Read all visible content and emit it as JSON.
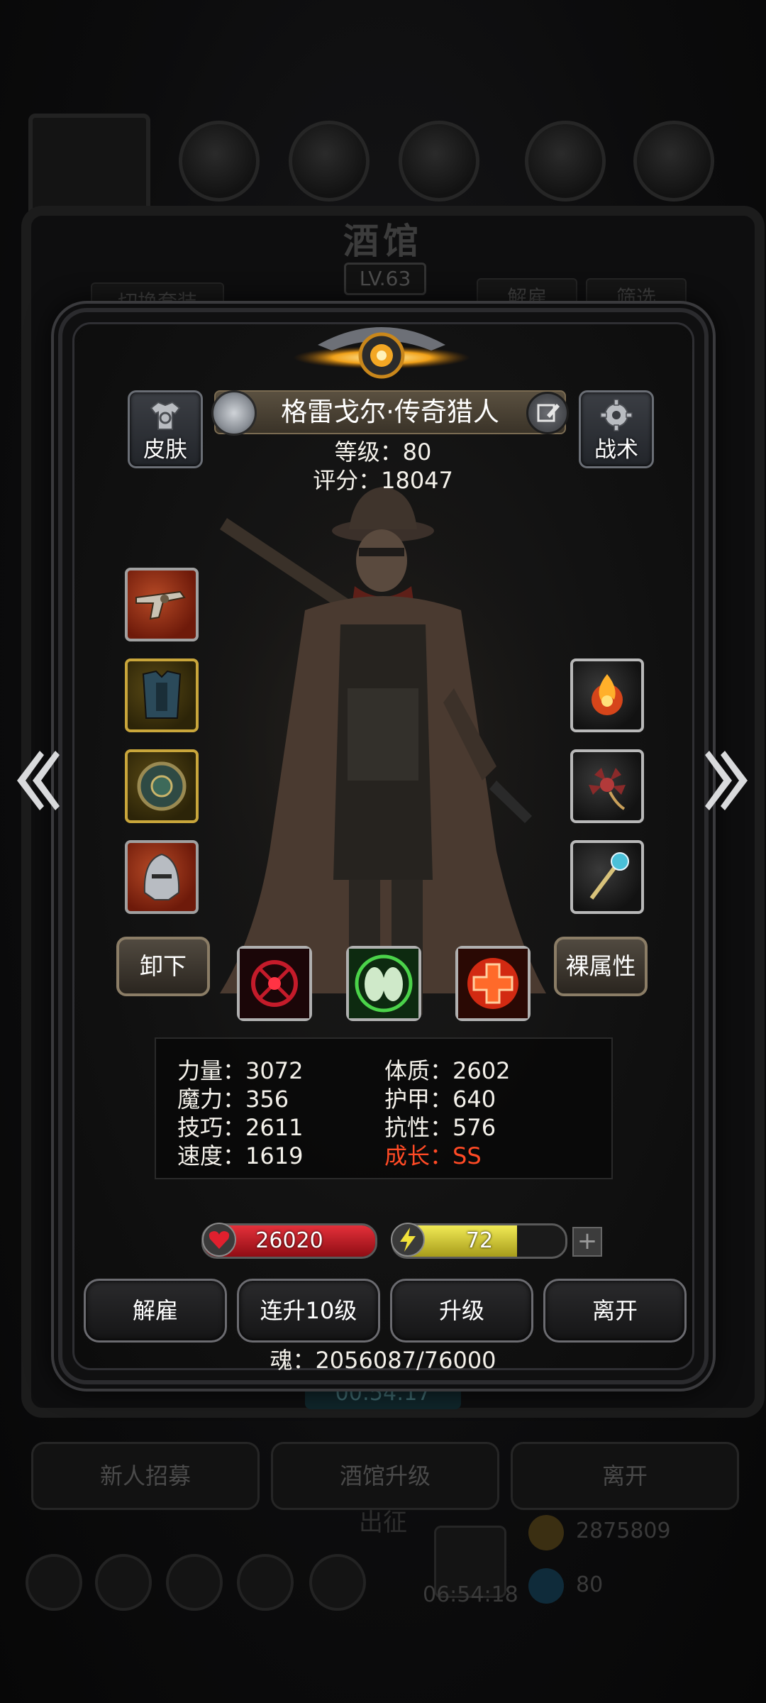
{
  "background": {
    "title": "酒馆",
    "level": "LV.63",
    "switch_outfit": "切换套装",
    "dismiss": "解雇",
    "filter": "筛选",
    "timer": "00:54:17",
    "bottom_buttons": [
      "新人招募",
      "酒馆升级",
      "离开"
    ],
    "sortie": "出征",
    "gold": "2875809",
    "dock_timer": "06:54:18",
    "gems": "80"
  },
  "hero": {
    "name": "格雷戈尔·传奇猎人",
    "level_text": "等级：80",
    "score_text": "评分：18047",
    "skin_label": "皮肤",
    "tactics_label": "战术",
    "unequip_label": "卸下",
    "base_attr_label": "裸属性"
  },
  "equipment_left": [
    "revolver-icon",
    "armor-icon",
    "shield-icon",
    "helmet-icon"
  ],
  "equipment_right": [
    "fire-orb-icon",
    "spiked-flail-icon",
    "scepter-icon"
  ],
  "skills": [
    "target-skill-icon",
    "green-skill-icon",
    "heal-skill-icon"
  ],
  "attributes": {
    "strength": "力量：3072",
    "constitution": "体质：2602",
    "magic": "魔力：356",
    "armor": "护甲：640",
    "skill": "技巧：2611",
    "resistance": "抗性：576",
    "speed": "速度：1619",
    "growth": "成长：SS"
  },
  "hp": {
    "value": "26020",
    "fill": 1.0
  },
  "energy": {
    "value": "72",
    "fill": 0.72,
    "plus": "+"
  },
  "actions": {
    "dismiss": "解雇",
    "upgrade10": "连升10级",
    "upgrade": "升级",
    "leave": "离开"
  },
  "soul_text": "魂：2056087/76000",
  "colors": {
    "growth": "#ff4a25",
    "hp": "#e4303a",
    "energy": "#f1ea55"
  }
}
